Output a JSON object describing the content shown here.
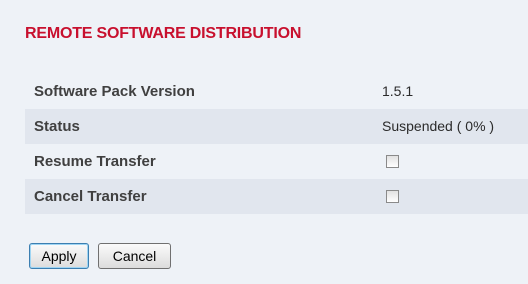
{
  "section": {
    "title": "REMOTE SOFTWARE DISTRIBUTION"
  },
  "rows": [
    {
      "label": "Software Pack Version",
      "value": "1.5.1"
    },
    {
      "label": "Status",
      "value": "Suspended ( 0% )"
    },
    {
      "label": "Resume Transfer",
      "checked": false
    },
    {
      "label": "Cancel Transfer",
      "checked": false
    }
  ],
  "buttons": {
    "apply": "Apply",
    "cancel": "Cancel"
  }
}
